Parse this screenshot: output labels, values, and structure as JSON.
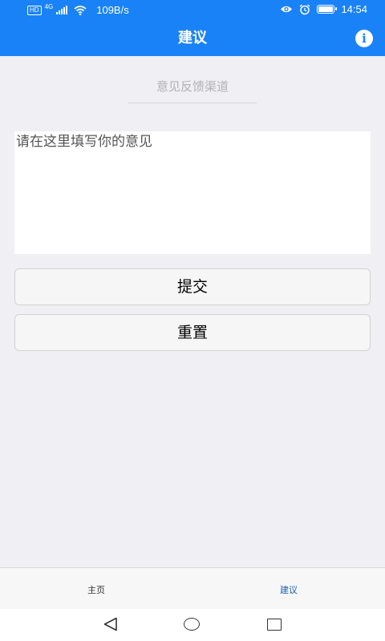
{
  "status_bar": {
    "hd": "HD",
    "network_type": "4G",
    "speed": "109B/s",
    "time": "14:54",
    "battery_level": 0.9,
    "icons": [
      "hd-badge",
      "signal-icon",
      "wifi-icon",
      "eye-icon",
      "alarm-icon",
      "battery-icon"
    ]
  },
  "app_bar": {
    "title": "建议",
    "info_icon_glyph": "i"
  },
  "feedback": {
    "section_label": "意见反馈渠道",
    "input_placeholder": "请在这里填写你的意见",
    "submit_label": "提交",
    "reset_label": "重置"
  },
  "tab_bar": {
    "tabs": [
      {
        "label": "主页",
        "active": false
      },
      {
        "label": "建议",
        "active": true
      }
    ],
    "active_color": "#1a5fb0"
  },
  "nav_bar": {
    "icons": [
      "back-icon",
      "home-icon",
      "recent-apps-icon"
    ]
  },
  "colors": {
    "primary": "#1a82f7",
    "background": "#efeff4"
  }
}
